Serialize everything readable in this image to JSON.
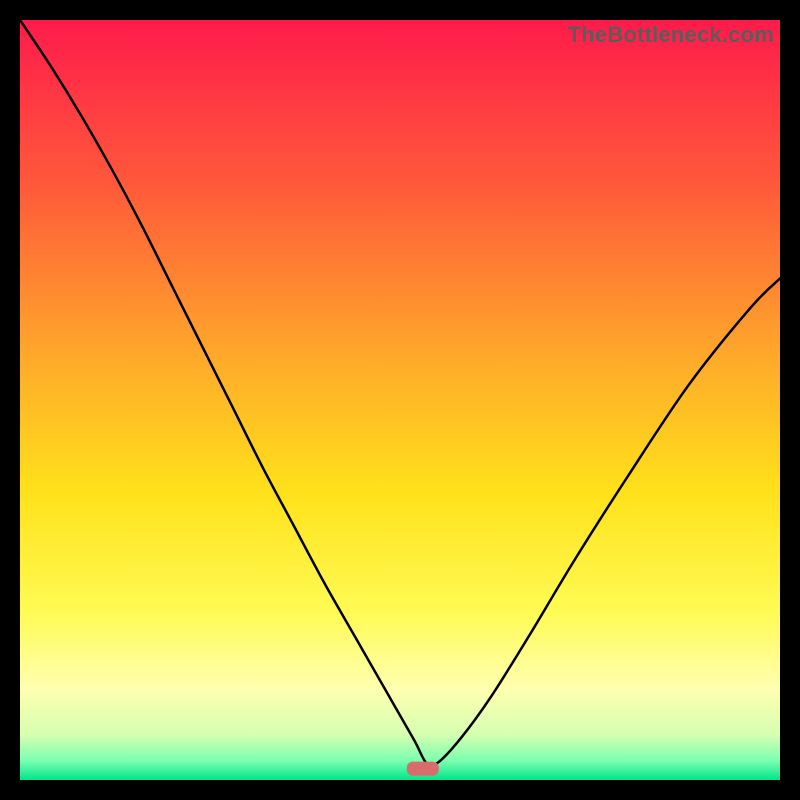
{
  "watermark": "TheBottleneck.com",
  "chart_data": {
    "type": "line",
    "title": "",
    "xlabel": "",
    "ylabel": "",
    "xlim": [
      0,
      100
    ],
    "ylim": [
      0,
      100
    ],
    "grid": false,
    "legend": false,
    "annotations": [
      {
        "name": "optimal-marker",
        "x": 53,
        "y": 1.5,
        "color": "#d86b6b"
      }
    ],
    "gradient_stops": [
      {
        "offset": 0.0,
        "color": "#ff1b4b"
      },
      {
        "offset": 0.22,
        "color": "#ff5a3a"
      },
      {
        "offset": 0.45,
        "color": "#ffab2a"
      },
      {
        "offset": 0.62,
        "color": "#ffe11a"
      },
      {
        "offset": 0.78,
        "color": "#fffb55"
      },
      {
        "offset": 0.88,
        "color": "#ffffb0"
      },
      {
        "offset": 0.94,
        "color": "#d6ffb0"
      },
      {
        "offset": 0.975,
        "color": "#7affb0"
      },
      {
        "offset": 1.0,
        "color": "#00e58a"
      }
    ],
    "series": [
      {
        "name": "bottleneck-curve",
        "color": "#000000",
        "x": [
          0.0,
          4,
          8,
          12,
          16,
          20,
          24,
          28,
          32,
          36,
          40,
          44,
          48,
          50,
          52,
          53.5,
          55,
          58,
          62,
          67,
          73,
          80,
          88,
          96,
          100
        ],
        "y": [
          100,
          94,
          87.5,
          80.5,
          73,
          65,
          57,
          49,
          41,
          33.5,
          26,
          19,
          12,
          8.5,
          5,
          2.2,
          2.3,
          5.5,
          11,
          19,
          29,
          40,
          52,
          62,
          66
        ]
      }
    ]
  }
}
